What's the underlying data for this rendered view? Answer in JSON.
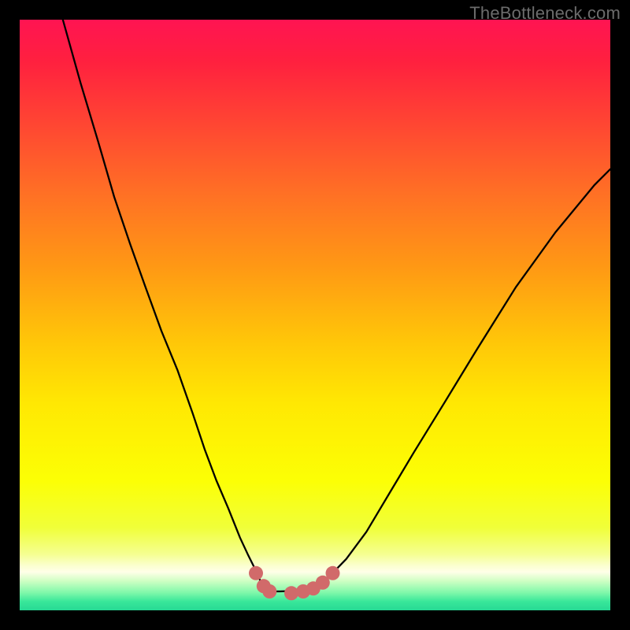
{
  "watermark": "TheBottleneck.com",
  "chart_data": {
    "type": "line",
    "title": "",
    "xlabel": "",
    "ylabel": "",
    "xlim": [
      0,
      100
    ],
    "ylim": [
      0,
      100
    ],
    "gradient_stops": [
      {
        "offset": 0.0,
        "color": "#ff1452"
      },
      {
        "offset": 0.07,
        "color": "#ff203f"
      },
      {
        "offset": 0.18,
        "color": "#ff4732"
      },
      {
        "offset": 0.3,
        "color": "#ff7224"
      },
      {
        "offset": 0.42,
        "color": "#ff9914"
      },
      {
        "offset": 0.55,
        "color": "#ffc808"
      },
      {
        "offset": 0.65,
        "color": "#ffe803"
      },
      {
        "offset": 0.78,
        "color": "#fcff05"
      },
      {
        "offset": 0.86,
        "color": "#f0ff39"
      },
      {
        "offset": 0.905,
        "color": "#f5ff91"
      },
      {
        "offset": 0.925,
        "color": "#fbffd1"
      },
      {
        "offset": 0.935,
        "color": "#ffffe8"
      },
      {
        "offset": 0.95,
        "color": "#d0ffc4"
      },
      {
        "offset": 0.97,
        "color": "#80f8aa"
      },
      {
        "offset": 0.985,
        "color": "#39e79a"
      },
      {
        "offset": 1.0,
        "color": "#27d994"
      }
    ],
    "series": [
      {
        "name": "bottleneck-curve",
        "x": [
          7.3,
          10.3,
          13.3,
          16.0,
          18.7,
          21.3,
          24.0,
          26.7,
          29.3,
          31.3,
          33.3,
          35.3,
          37.3,
          38.7,
          40.0,
          41.0,
          42.0,
          42.7,
          44.0,
          46.7,
          49.3,
          52.0,
          55.3,
          58.7,
          62.7,
          66.7,
          72.0,
          77.3,
          84.0,
          90.7,
          97.3,
          100.0
        ],
        "y": [
          100.0,
          89.3,
          79.3,
          70.0,
          62.0,
          54.7,
          47.3,
          40.7,
          33.3,
          27.3,
          22.0,
          17.3,
          12.3,
          9.3,
          6.7,
          4.4,
          3.5,
          3.2,
          3.2,
          3.3,
          3.9,
          5.3,
          8.7,
          13.3,
          20.0,
          26.7,
          35.3,
          44.0,
          54.7,
          64.0,
          72.0,
          74.7
        ]
      }
    ],
    "markers": {
      "color": "#d16a6a",
      "radius_px": 9,
      "points": [
        {
          "x": 40.0,
          "y": 6.3
        },
        {
          "x": 41.3,
          "y": 4.1
        },
        {
          "x": 42.3,
          "y": 3.2
        },
        {
          "x": 46.0,
          "y": 2.9
        },
        {
          "x": 48.0,
          "y": 3.2
        },
        {
          "x": 49.7,
          "y": 3.7
        },
        {
          "x": 51.3,
          "y": 4.7
        },
        {
          "x": 53.0,
          "y": 6.3
        }
      ]
    }
  }
}
